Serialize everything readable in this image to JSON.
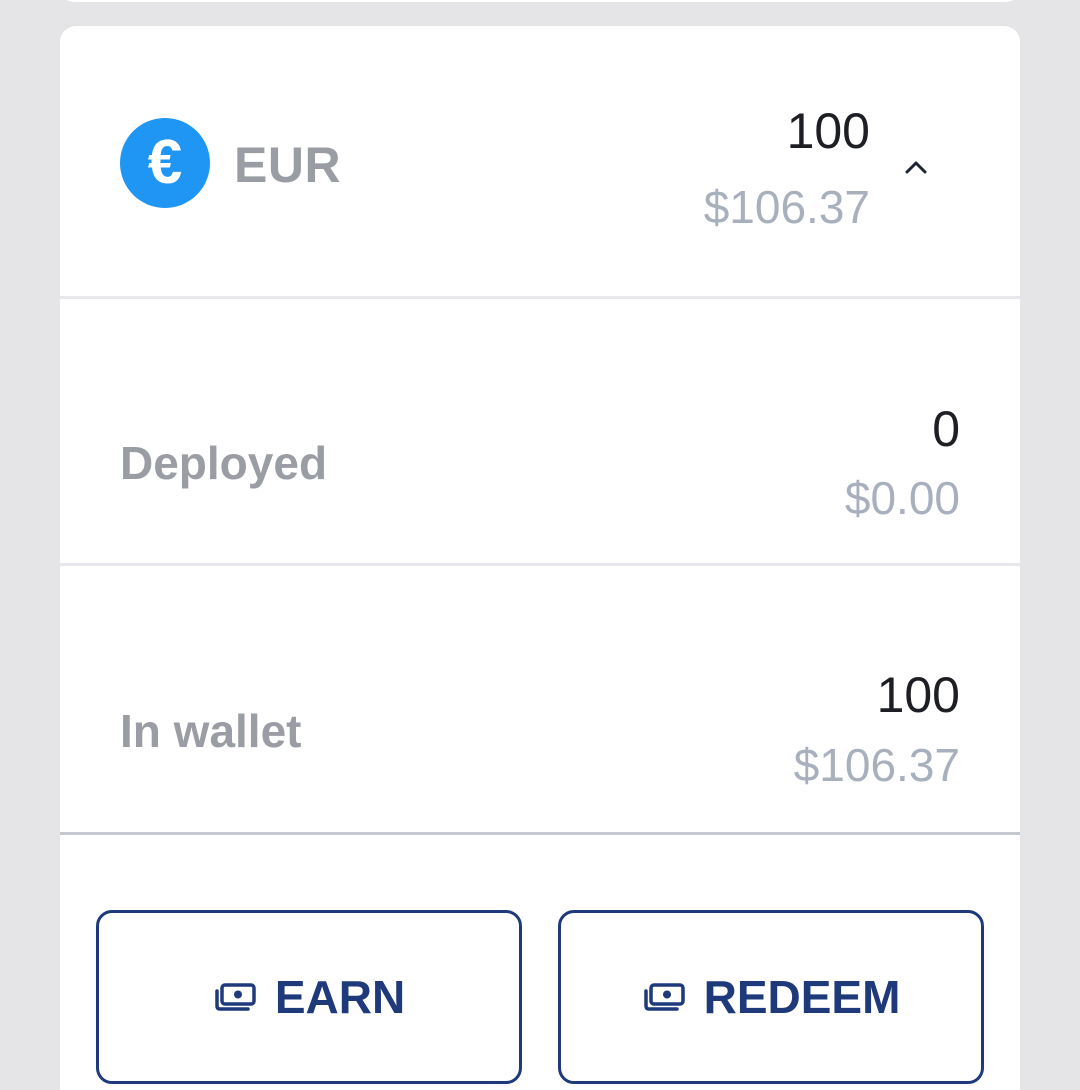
{
  "asset": {
    "icon": "euro-icon",
    "icon_glyph": "€",
    "icon_color": "#1f96f3",
    "symbol": "EUR",
    "amount": "100",
    "usd_value": "$106.37",
    "expand_icon": "chevron-up-icon"
  },
  "rows": {
    "deployed": {
      "label": "Deployed",
      "amount": "0",
      "usd_value": "$0.00"
    },
    "in_wallet": {
      "label": "In wallet",
      "amount": "100",
      "usd_value": "$106.37"
    }
  },
  "actions": {
    "earn_label": "EARN",
    "earn_icon": "money-stack-icon",
    "redeem_label": "REDEEM",
    "redeem_icon": "money-stack-icon",
    "accent_color": "#1e3a7b"
  }
}
